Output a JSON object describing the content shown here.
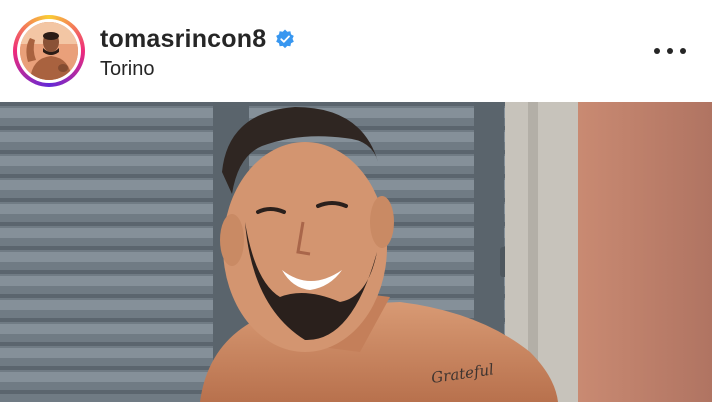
{
  "post": {
    "username": "tomasrincon8",
    "verified": true,
    "location": "Torino",
    "more_icon": "more-horizontal-icon",
    "verified_icon": "verified-badge-icon"
  },
  "colors": {
    "verified_blue": "#3897f0",
    "text": "#262626",
    "ring_gradient": [
      "#f9ce34",
      "#ee2a7b",
      "#6228d7"
    ]
  },
  "photo": {
    "tattoo_text": "Grateful"
  }
}
